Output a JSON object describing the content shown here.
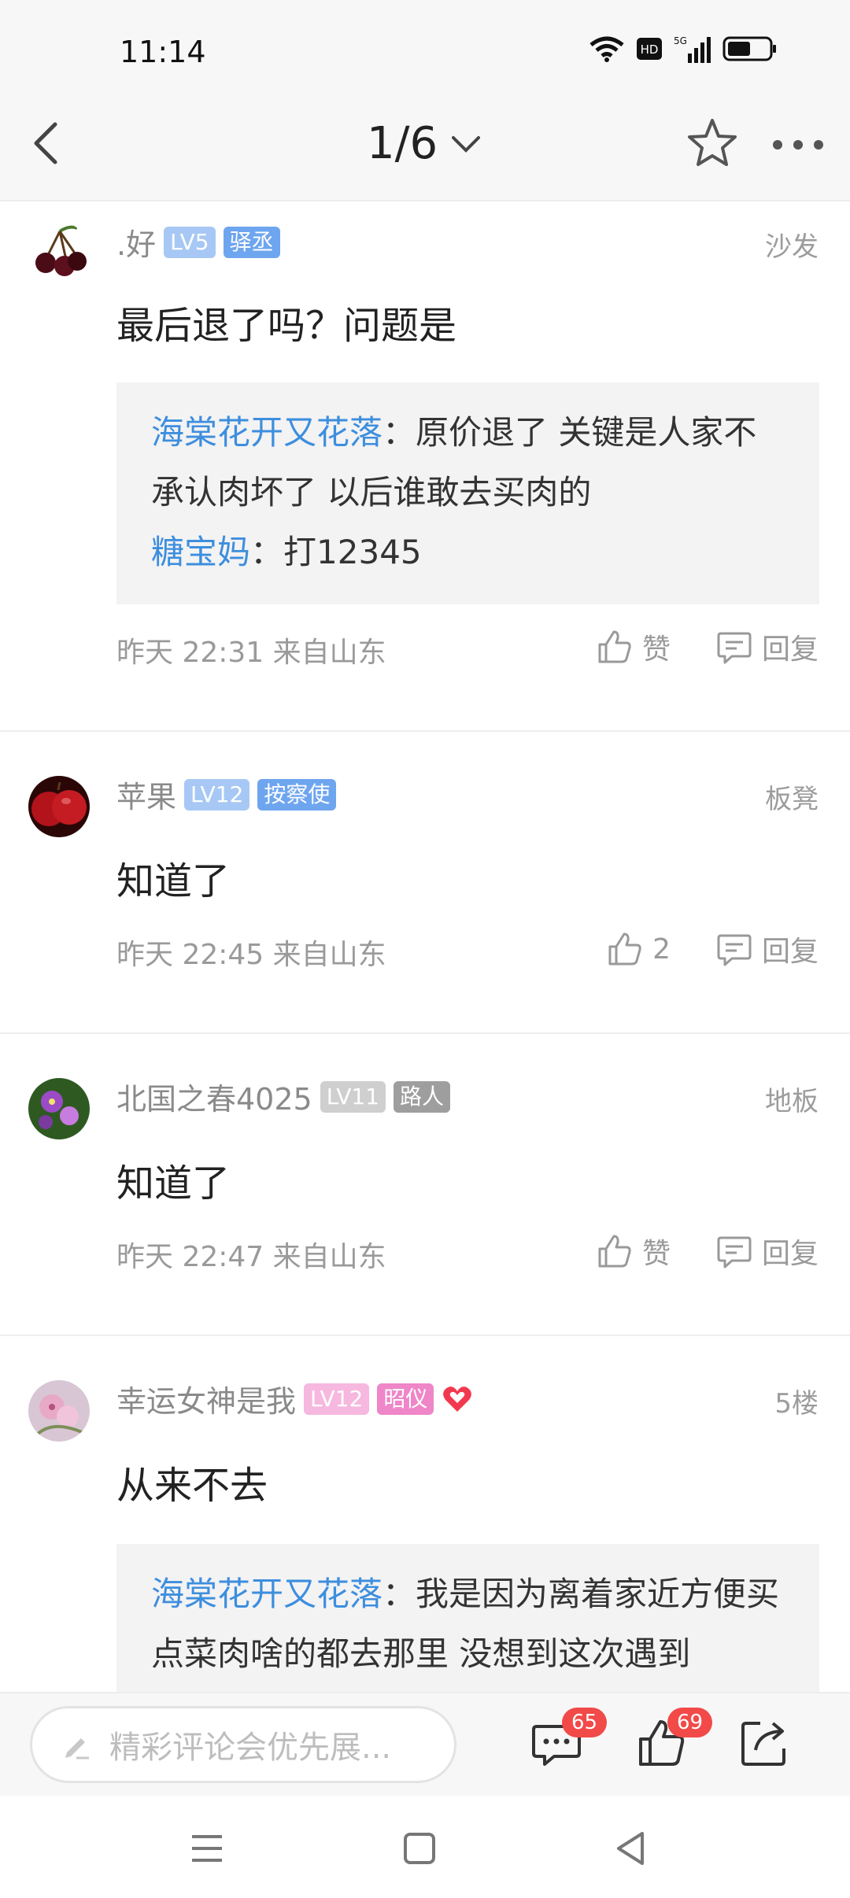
{
  "status_bar": {
    "time": "11:14",
    "network": "5G"
  },
  "header": {
    "page_indicator": "1/6"
  },
  "comments": [
    {
      "username": ".好",
      "level": "LV5",
      "title": "驿丞",
      "floor": "沙发",
      "text": "最后退了吗？问题是",
      "quotes": [
        {
          "name": "海棠花开又花落",
          "sep": "：",
          "text": "原价退了 关键是人家不承认肉坏了 以后谁敢去买肉的"
        },
        {
          "name": "糖宝妈",
          "sep": "：",
          "text": "打12345"
        }
      ],
      "time": "昨天 22:31 来自山东",
      "like_label": "赞",
      "reply_label": "回复"
    },
    {
      "username": "苹果",
      "level": "LV12",
      "title": "按察使",
      "floor": "板凳",
      "text": "知道了",
      "time": "昨天 22:45 来自山东",
      "like_label": "2",
      "reply_label": "回复"
    },
    {
      "username": "北国之春4025",
      "level": "LV11",
      "title": "路人",
      "floor": "地板",
      "text": "知道了",
      "time": "昨天 22:47 来自山东",
      "like_label": "赞",
      "reply_label": "回复"
    },
    {
      "username": "幸运女神是我",
      "level": "LV12",
      "title": "昭仪",
      "floor": "5楼",
      "text": "从来不去",
      "quotes": [
        {
          "name": "海棠花开又花落",
          "sep": "：",
          "text": "我是因为离着家近方便买点菜肉啥的都去那里 没想到这次遇到"
        }
      ]
    }
  ],
  "bottom_bar": {
    "input_placeholder": "精彩评论会优先展...",
    "comment_count": "65",
    "like_count": "69"
  },
  "colors": {
    "link": "#3d8ede",
    "badge": "#f24949",
    "lv_blue": "#a7c8f4",
    "tag_blue": "#6ea5ef"
  }
}
